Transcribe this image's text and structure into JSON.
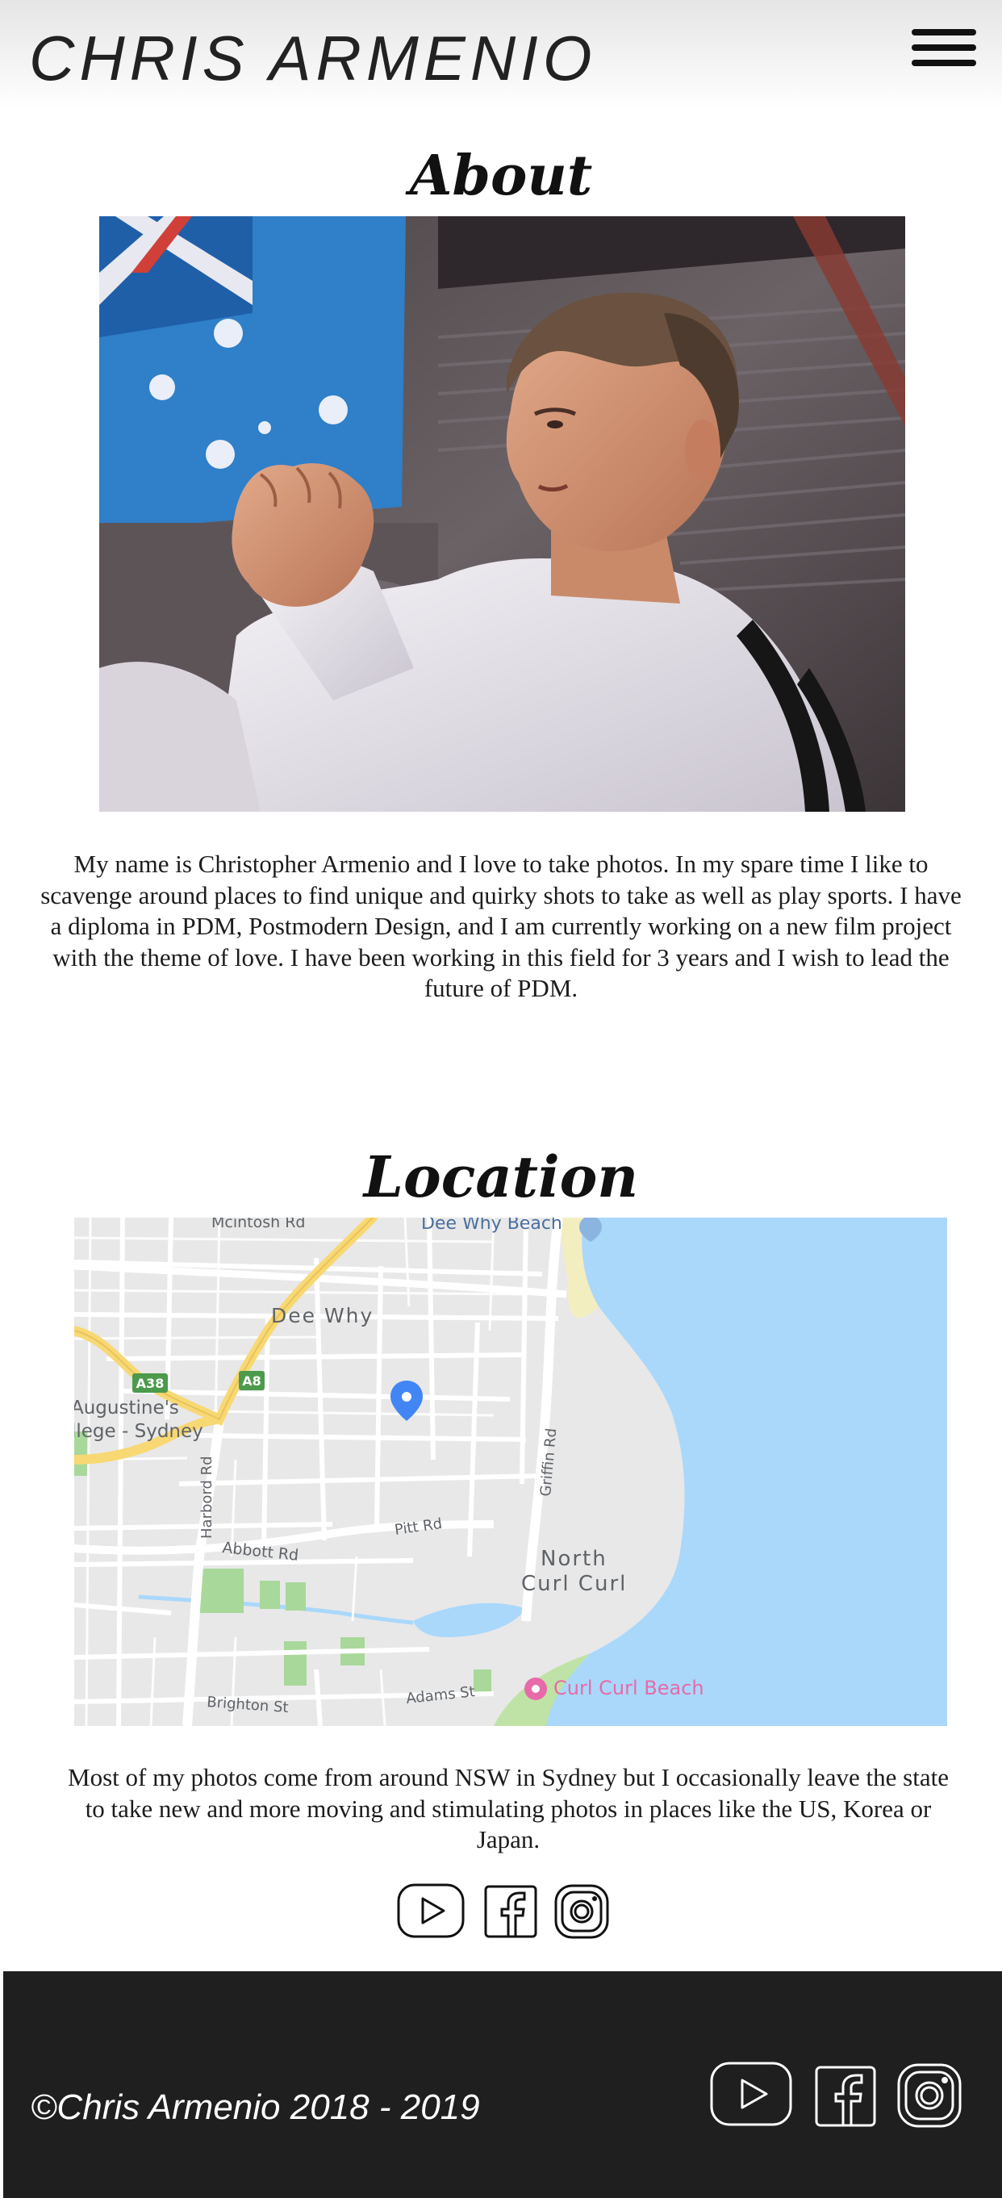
{
  "header": {
    "site_name": "CHRIS ARMENIO",
    "menu_icon": "hamburger-menu-icon"
  },
  "about": {
    "title": "About",
    "photo": "photo of a young man in a white martial-arts uniform raising a fist, Australian flag in background",
    "text": "My name is Christopher Armenio and I love to take photos. In my spare time I like to scavenge around places to find unique and quirky shots to take as well as play sports. I have a diploma in PDM, Postmodern Design, and I am currently working on a new film project with the theme of love. I have been working in this field for 3 years and I wish to lead the future of PDM."
  },
  "location": {
    "title": "Location",
    "map": {
      "labels": {
        "road_mcintosh": "Mcintosh Rd",
        "dee_why_beach": "Dee Why Beach",
        "dee_why": "Dee Why",
        "a38": "A38",
        "a8": "A8",
        "augustine_line1": "Augustine's",
        "augustine_line2": "llege - Sydney",
        "harbord_rd": "Harbord Rd",
        "griffin_rd": "Griffin Rd",
        "pitt_rd": "Pitt Rd",
        "abbott_rd": "Abbott Rd",
        "north_curl_curl_line1": "North",
        "north_curl_curl_line2": "Curl Curl",
        "curl_curl_beach": "Curl Curl Beach",
        "brighton_st": "Brighton St",
        "adams_st": "Adams St"
      }
    },
    "text": "Most of my photos come from around NSW in Sydney but I occasionally leave the state to take new and more moving and stimulating photos in places like the US, Korea or Japan."
  },
  "social_icons": [
    "youtube-icon",
    "facebook-icon",
    "instagram-icon"
  ],
  "footer": {
    "copyright": "©Chris Armenio 2018 - 2019"
  },
  "colors": {
    "footer_bg": "#1f1f1f",
    "water": "#a9d8fb",
    "land": "#e8e8e8",
    "highway": "#f8d873",
    "park": "#a8d89a",
    "route_shield": "#4c9a4c"
  }
}
